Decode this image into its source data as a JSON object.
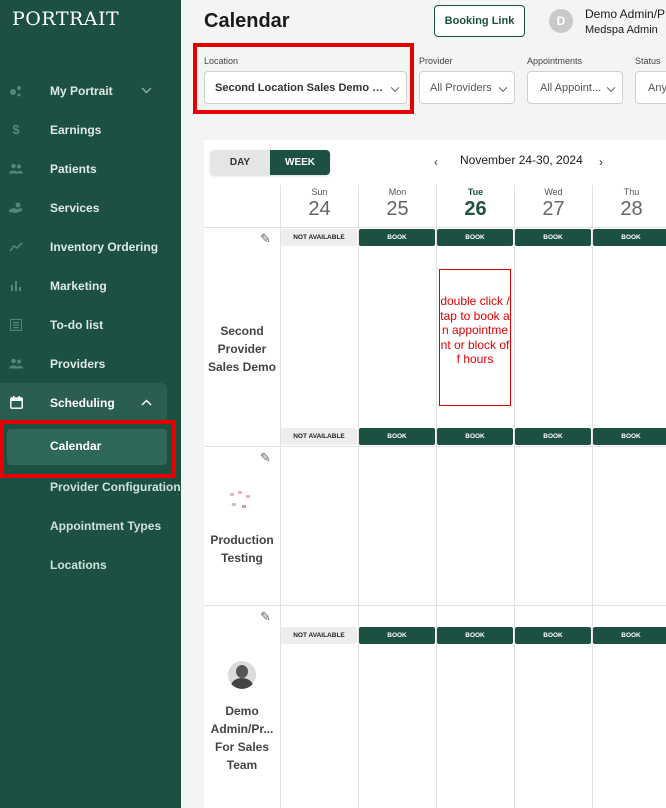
{
  "sidebar": {
    "logo": "PORTRAIT",
    "items": [
      {
        "label": "My Portrait",
        "icon": "dots-icon"
      },
      {
        "label": "Earnings",
        "icon": "dollar-icon"
      },
      {
        "label": "Patients",
        "icon": "people-icon"
      },
      {
        "label": "Services",
        "icon": "hand-icon"
      },
      {
        "label": "Inventory Ordering",
        "icon": "trend-icon"
      },
      {
        "label": "Marketing",
        "icon": "bar-chart-icon"
      },
      {
        "label": "To-do list",
        "icon": "list-icon"
      },
      {
        "label": "Providers",
        "icon": "people-icon"
      },
      {
        "label": "Scheduling",
        "icon": "calendar-icon"
      }
    ],
    "sub_items": [
      {
        "label": "Calendar"
      },
      {
        "label": "Provider Configuration"
      },
      {
        "label": "Appointment Types"
      },
      {
        "label": "Locations"
      }
    ]
  },
  "header": {
    "title": "Calendar",
    "booking_link": "Booking Link",
    "avatar_initial": "D",
    "user_name": "Demo Admin/P",
    "user_role": "Medspa Admin"
  },
  "filters": {
    "location": {
      "label": "Location",
      "value": "Second Location Sales Demo / ST..."
    },
    "provider": {
      "label": "Provider",
      "value": "All Providers"
    },
    "appointments": {
      "label": "Appointments",
      "value": "All Appoint..."
    },
    "status": {
      "label": "Status",
      "value": "Any"
    }
  },
  "calendar": {
    "view_day": "DAY",
    "view_week": "WEEK",
    "prev": "‹",
    "next": "›",
    "date_range": "November 24-30, 2024",
    "days": [
      {
        "name": "Sun",
        "date": "24"
      },
      {
        "name": "Mon",
        "date": "25"
      },
      {
        "name": "Tue",
        "date": "26"
      },
      {
        "name": "Wed",
        "date": "27"
      },
      {
        "name": "Thu",
        "date": "28"
      }
    ],
    "not_available": "NOT AVAILABLE",
    "book": "BOOK",
    "providers": [
      {
        "name": "Second Provider Sales Demo"
      },
      {
        "name": "Production Testing"
      },
      {
        "name": "Demo Admin/Pr... For Sales Team"
      }
    ],
    "hint": "double click / tap to book an appointment or block off hours",
    "colors": {
      "brand": "#1c5043",
      "highlight": "#e60000"
    }
  }
}
